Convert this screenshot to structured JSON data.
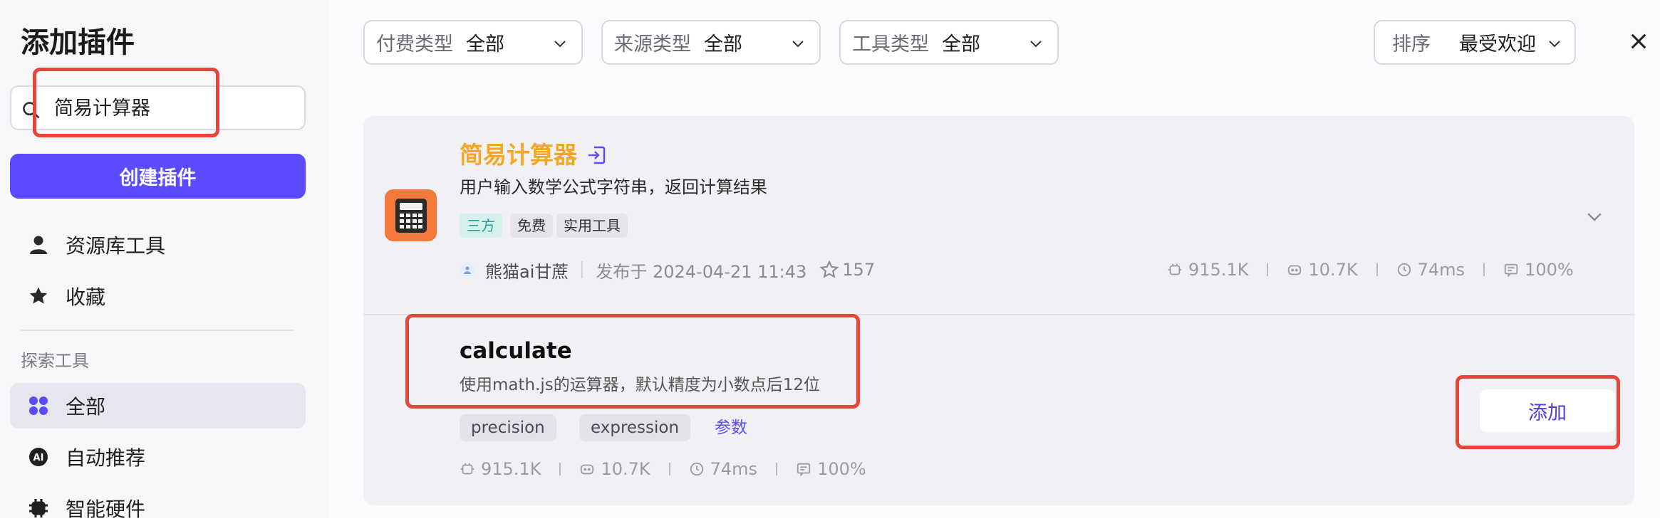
{
  "sidebar": {
    "title": "添加插件",
    "search": {
      "value": "简易计算器"
    },
    "create_button": "创建插件",
    "items": [
      {
        "label": "资源库工具",
        "icon": "user-icon"
      },
      {
        "label": "收藏",
        "icon": "star-icon"
      }
    ],
    "explore_label": "探索工具",
    "explore_items": [
      {
        "label": "全部",
        "icon": "grid-icon",
        "active": true
      },
      {
        "label": "自动推荐",
        "icon": "ai-icon"
      },
      {
        "label": "智能硬件",
        "icon": "chip-icon"
      }
    ]
  },
  "filters": [
    {
      "label": "付费类型",
      "value": "全部"
    },
    {
      "label": "来源类型",
      "value": "全部"
    },
    {
      "label": "工具类型",
      "value": "全部"
    }
  ],
  "sort": {
    "label": "排序",
    "value": "最受欢迎"
  },
  "plugin": {
    "name": "简易计算器",
    "description": "用户输入数学公式字符串，返回计算结果",
    "tags": [
      "三方",
      "免费",
      "实用工具"
    ],
    "author": "熊猫ai甘蔗",
    "published": "发布于 2024-04-21 11:43",
    "stars": "157",
    "stats": {
      "calls": "915.1K",
      "bots": "10.7K",
      "latency": "74ms",
      "success": "100%"
    }
  },
  "tool": {
    "name": "calculate",
    "description": "使用math.js的运算器，默认精度为小数点后12位",
    "params": [
      "precision",
      "expression"
    ],
    "params_link": "参数",
    "stats": {
      "calls": "915.1K",
      "bots": "10.7K",
      "latency": "74ms",
      "success": "100%"
    },
    "add_button": "添加"
  },
  "colors": {
    "accent": "#5b4bff",
    "plugin_name": "#f5a623",
    "highlight": "#e8443a",
    "tag_third_bg": "#d6f0ec",
    "tag_third_fg": "#1aa38f"
  }
}
